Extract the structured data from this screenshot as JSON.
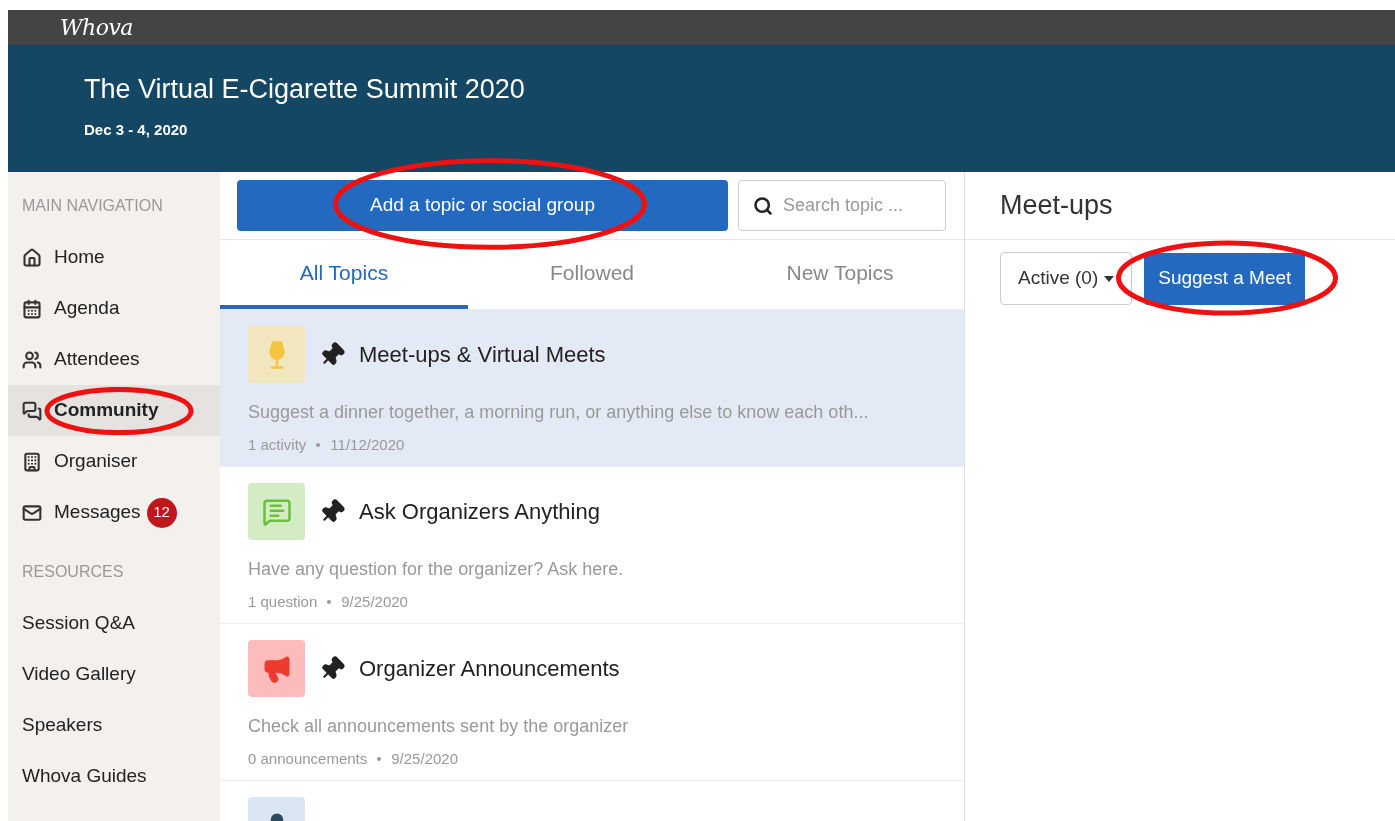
{
  "topbar": {
    "logo": "Whova"
  },
  "event": {
    "title": "The Virtual E-Cigarette Summit 2020",
    "dates": "Dec 3 - 4, 2020"
  },
  "sidebar": {
    "sections": [
      {
        "heading": "MAIN NAVIGATION",
        "items": [
          {
            "label": "Home",
            "kind": "home",
            "selected": false,
            "circled": false
          },
          {
            "label": "Agenda",
            "kind": "calendar",
            "selected": false,
            "circled": false
          },
          {
            "label": "Attendees",
            "kind": "users",
            "selected": false,
            "circled": false
          },
          {
            "label": "Community",
            "kind": "chat",
            "selected": true,
            "circled": true
          },
          {
            "label": "Organiser",
            "kind": "building",
            "selected": false,
            "circled": false
          },
          {
            "label": "Messages",
            "kind": "mail",
            "selected": false,
            "circled": false,
            "badge": "12"
          }
        ]
      },
      {
        "heading": "RESOURCES",
        "items": [
          {
            "label": "Session Q&A",
            "selected": false,
            "circled": false
          },
          {
            "label": "Video Gallery",
            "selected": false,
            "circled": false
          },
          {
            "label": "Speakers",
            "selected": false,
            "circled": false
          },
          {
            "label": "Whova Guides",
            "selected": false,
            "circled": false
          }
        ]
      }
    ]
  },
  "community": {
    "add_button": {
      "label": "Add a topic or social group",
      "circled": true
    },
    "search": {
      "placeholder": "Search topic ..."
    },
    "tabs": [
      {
        "label": "All Topics",
        "selected": true
      },
      {
        "label": "Followed",
        "selected": false
      },
      {
        "label": "New Topics",
        "selected": false
      }
    ],
    "topics": [
      {
        "kind": "meetup",
        "color": "#f2e6bf",
        "pinned": true,
        "selected": true,
        "title": "Meet-ups & Virtual Meets",
        "description": "Suggest a dinner together, a morning run, or anything else to know each oth...",
        "count": "1 activity",
        "date": "11/12/2020"
      },
      {
        "kind": "qa",
        "color": "#d4ecc4",
        "pinned": true,
        "selected": false,
        "title": "Ask Organizers Anything",
        "description": "Have any question for the organizer? Ask here.",
        "count": "1 question",
        "date": "9/25/2020"
      },
      {
        "kind": "announce",
        "color": "#fcbcbc",
        "pinned": true,
        "selected": false,
        "title": "Organizer Announcements",
        "description": "Check all announcements sent by the organizer",
        "count": "0 announcements",
        "date": "9/25/2020"
      },
      {
        "kind": "group",
        "color": "#dce6f2",
        "selected": false
      }
    ]
  },
  "meetups": {
    "title": "Meet-ups",
    "filter": "Active (0)",
    "suggest_button": {
      "label": "Suggest a Meet",
      "circled": true
    }
  }
}
